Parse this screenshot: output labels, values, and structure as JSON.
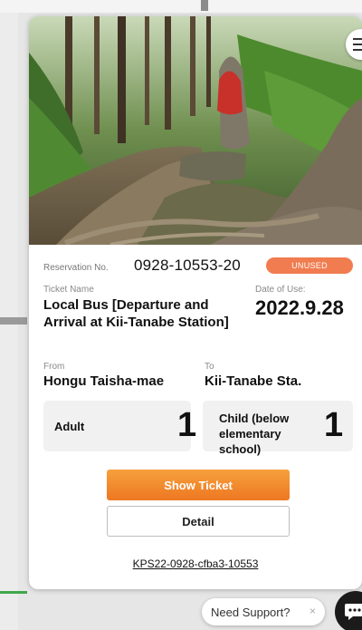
{
  "ticket": {
    "reservation_label": "Reservation No.",
    "reservation_number": "0928-10553-20",
    "status": "UNUSED",
    "name_label": "Ticket Name",
    "name": "Local Bus [Departure and Arrival at Kii-Tanabe Station]",
    "date_label": "Date of Use:",
    "date": "2022.9.28",
    "from_label": "From",
    "from": "Hongu Taisha-mae",
    "to_label": "To",
    "to": "Kii-Tanabe Sta.",
    "fares": [
      {
        "label": "Adult",
        "count": "1"
      },
      {
        "label": "Child (below elementary school)",
        "count": "1"
      }
    ],
    "show_ticket_label": "Show Ticket",
    "detail_label": "Detail",
    "code": "KPS22-0928-cfba3-10553"
  },
  "support": {
    "label": "Need Support?",
    "close": "×"
  },
  "colors": {
    "accent": "#ee7722",
    "status_badge": "#f07c4f",
    "chat": "#1b1b1b"
  }
}
